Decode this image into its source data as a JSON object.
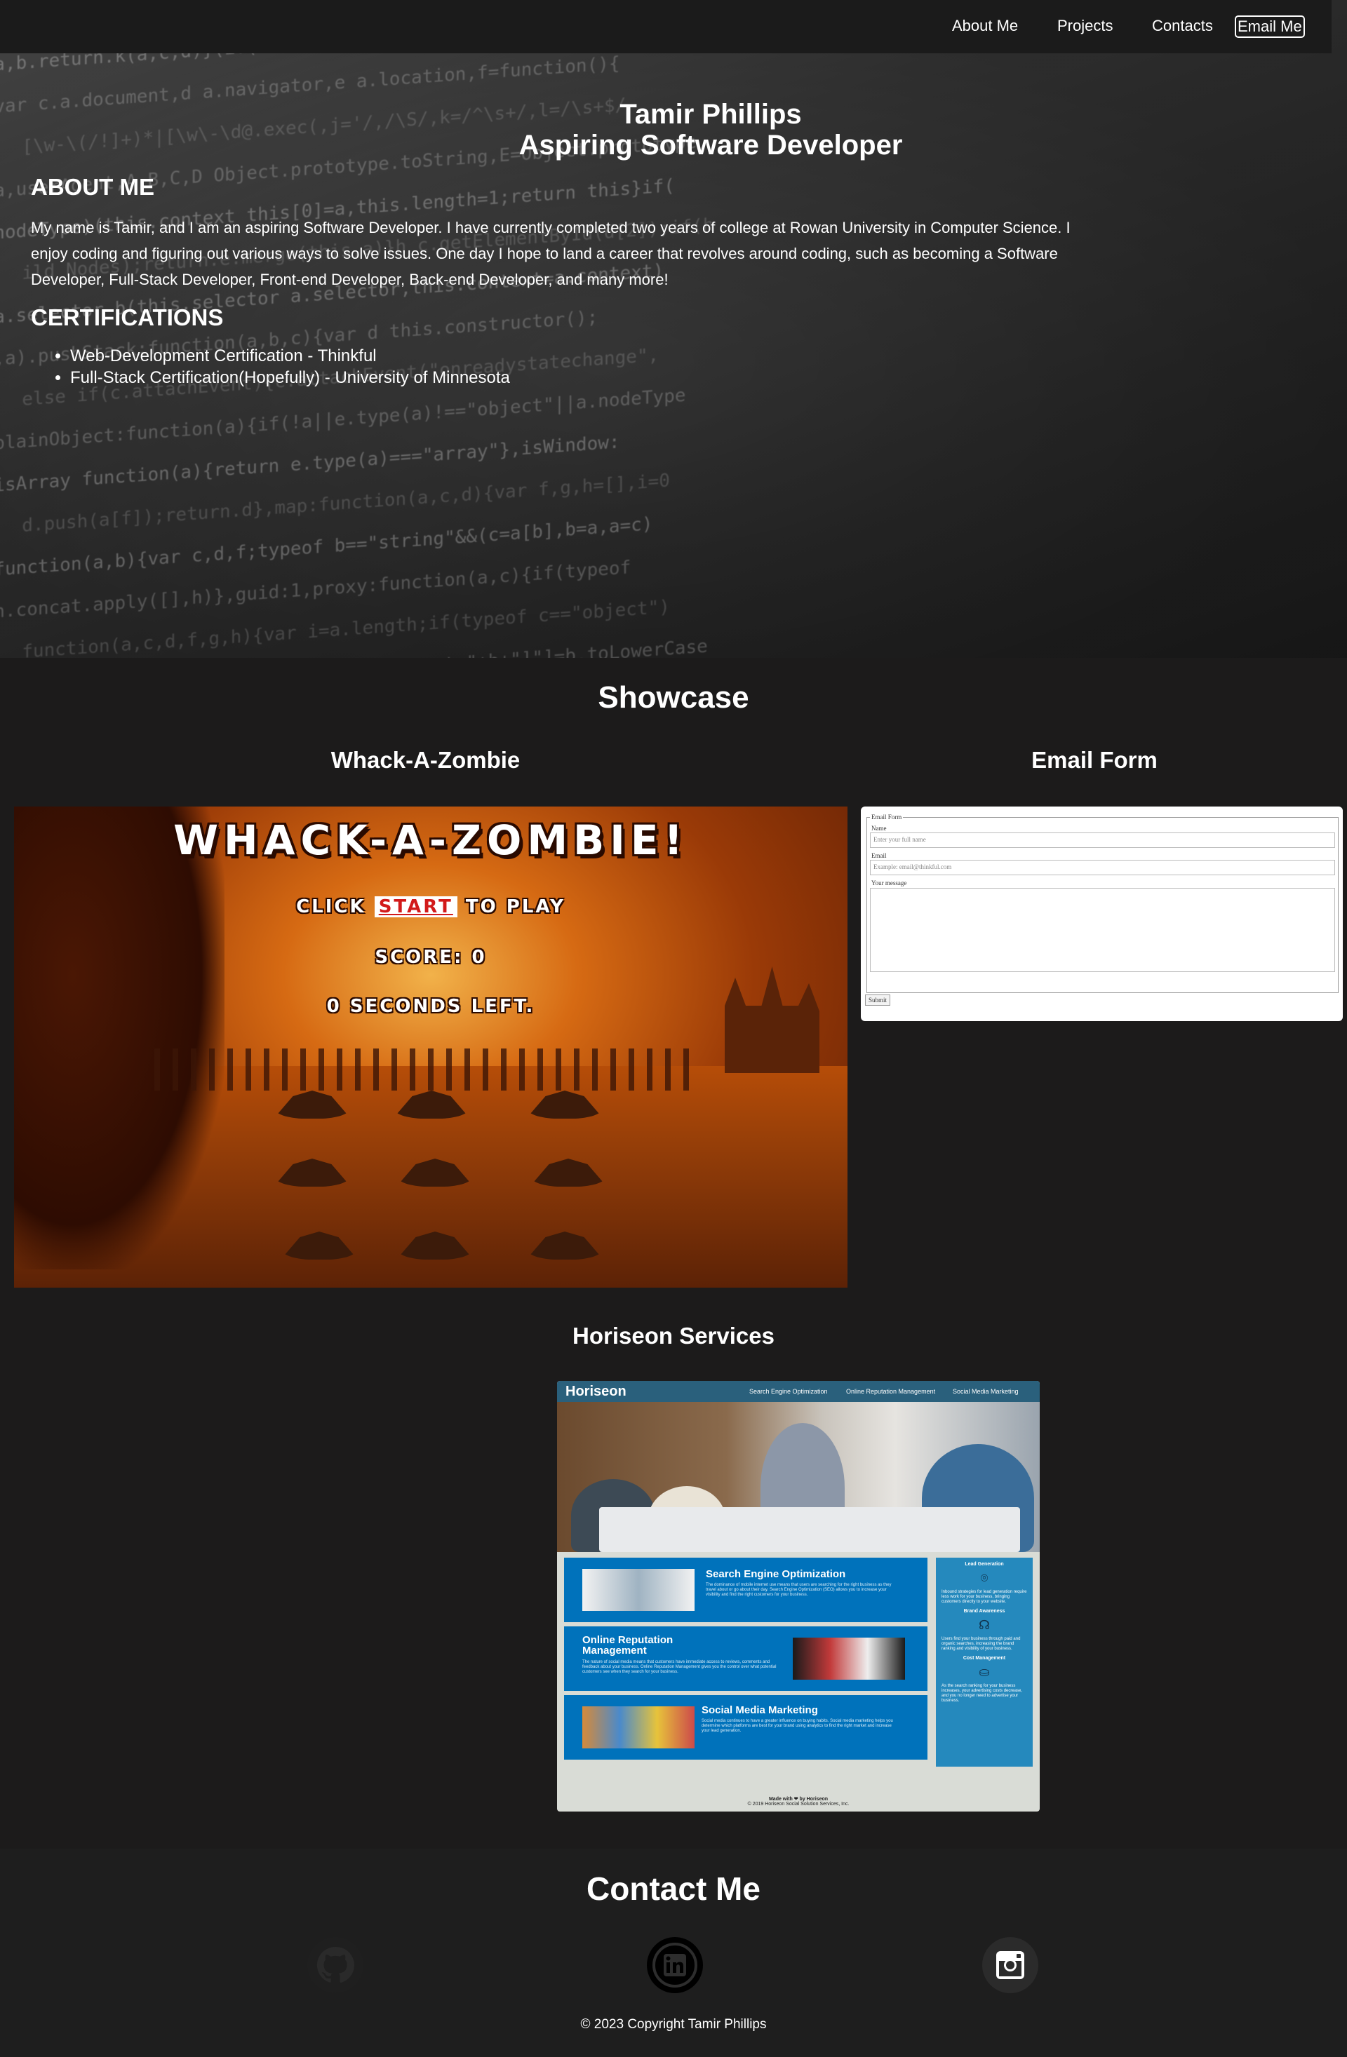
{
  "nav": {
    "about": "About Me",
    "projects": "Projects",
    "contacts": "Contacts",
    "email": "Email Me"
  },
  "hero": {
    "name": "Tamir Phillips",
    "role": "Aspiring Software Developer",
    "about_heading": "ABOUT ME",
    "about_text": "My name is Tamir, and I am an aspiring Software Developer. I have currently completed two years of college at Rowan University in Computer Science. I enjoy coding and figuring out various ways to solve issues. One day I hope to land a career that revolves around coding, such as becoming a Software Developer, Full-Stack Developer, Front-end Developer, Back-end Developer, and many more!",
    "cert_heading": "CERTIFICATIONS",
    "certs": [
      "Web-Development Certification - Thinkful",
      "Full-Stack Certification(Hopefully) - University of Minnesota"
    ]
  },
  "showcase": {
    "title": "Showcase",
    "projects": {
      "zombie": {
        "title": "Whack-A-Zombie",
        "game_title": "WHACK-A-ZOMBIE!",
        "click": "CLICK",
        "start": "START",
        "to_play": "TO PLAY",
        "score": "SCORE: 0",
        "seconds": "0 SECONDS LEFT."
      },
      "email": {
        "title": "Email Form",
        "legend": "Email Form",
        "name_label": "Name",
        "name_placeholder": "Enter your full name",
        "email_label": "Email",
        "email_placeholder": "Example: email@thinkful.com",
        "message_label": "Your message",
        "submit": "Submit"
      },
      "horiseon": {
        "title": "Horiseon Services",
        "logo": "Horiseon",
        "nav": [
          "Search Engine Optimization",
          "Online Reputation Management",
          "Social Media Marketing"
        ],
        "cards": [
          {
            "heading": "Search Engine Optimization",
            "text": "The dominance of mobile internet use means that users are searching for the right business as they travel about or go about their day. Search Engine Optimization (SEO) allows you to increase your visibility and find the right customers for your business."
          },
          {
            "heading": "Online Reputation Management",
            "text": "The nature of social media means that customers have immediate access to reviews, comments and feedback about your business. Online Reputation Management gives you the control over what potential customers see when they search for your business."
          },
          {
            "heading": "Social Media Marketing",
            "text": "Social media continues to have a greater influence on buying habits. Social media marketing helps you determine which platforms are best for your brand using analytics to find the right market and increase your lead generation."
          }
        ],
        "aside": [
          {
            "heading": "Lead Generation",
            "text": "Inbound strategies for lead generation require less work for your business, bringing customers directly to your website."
          },
          {
            "heading": "Brand Awareness",
            "text": "Users find your business through paid and organic searches, increasing the brand ranking and visibility of your business."
          },
          {
            "heading": "Cost Management",
            "text": "As the search ranking for your business increases, your advertising costs decrease, and you no longer need to advertise your business."
          }
        ],
        "footer_made": "Made with ❤ by Horiseon",
        "footer_copy": "© 2019 Horiseon Social Solution Services, Inc."
      }
    }
  },
  "contact": {
    "title": "Contact Me",
    "icons": [
      "github-icon",
      "linkedin-icon",
      "instagram-icon"
    ],
    "copyright": "© 2023 Copyright Tamir Phillips"
  }
}
